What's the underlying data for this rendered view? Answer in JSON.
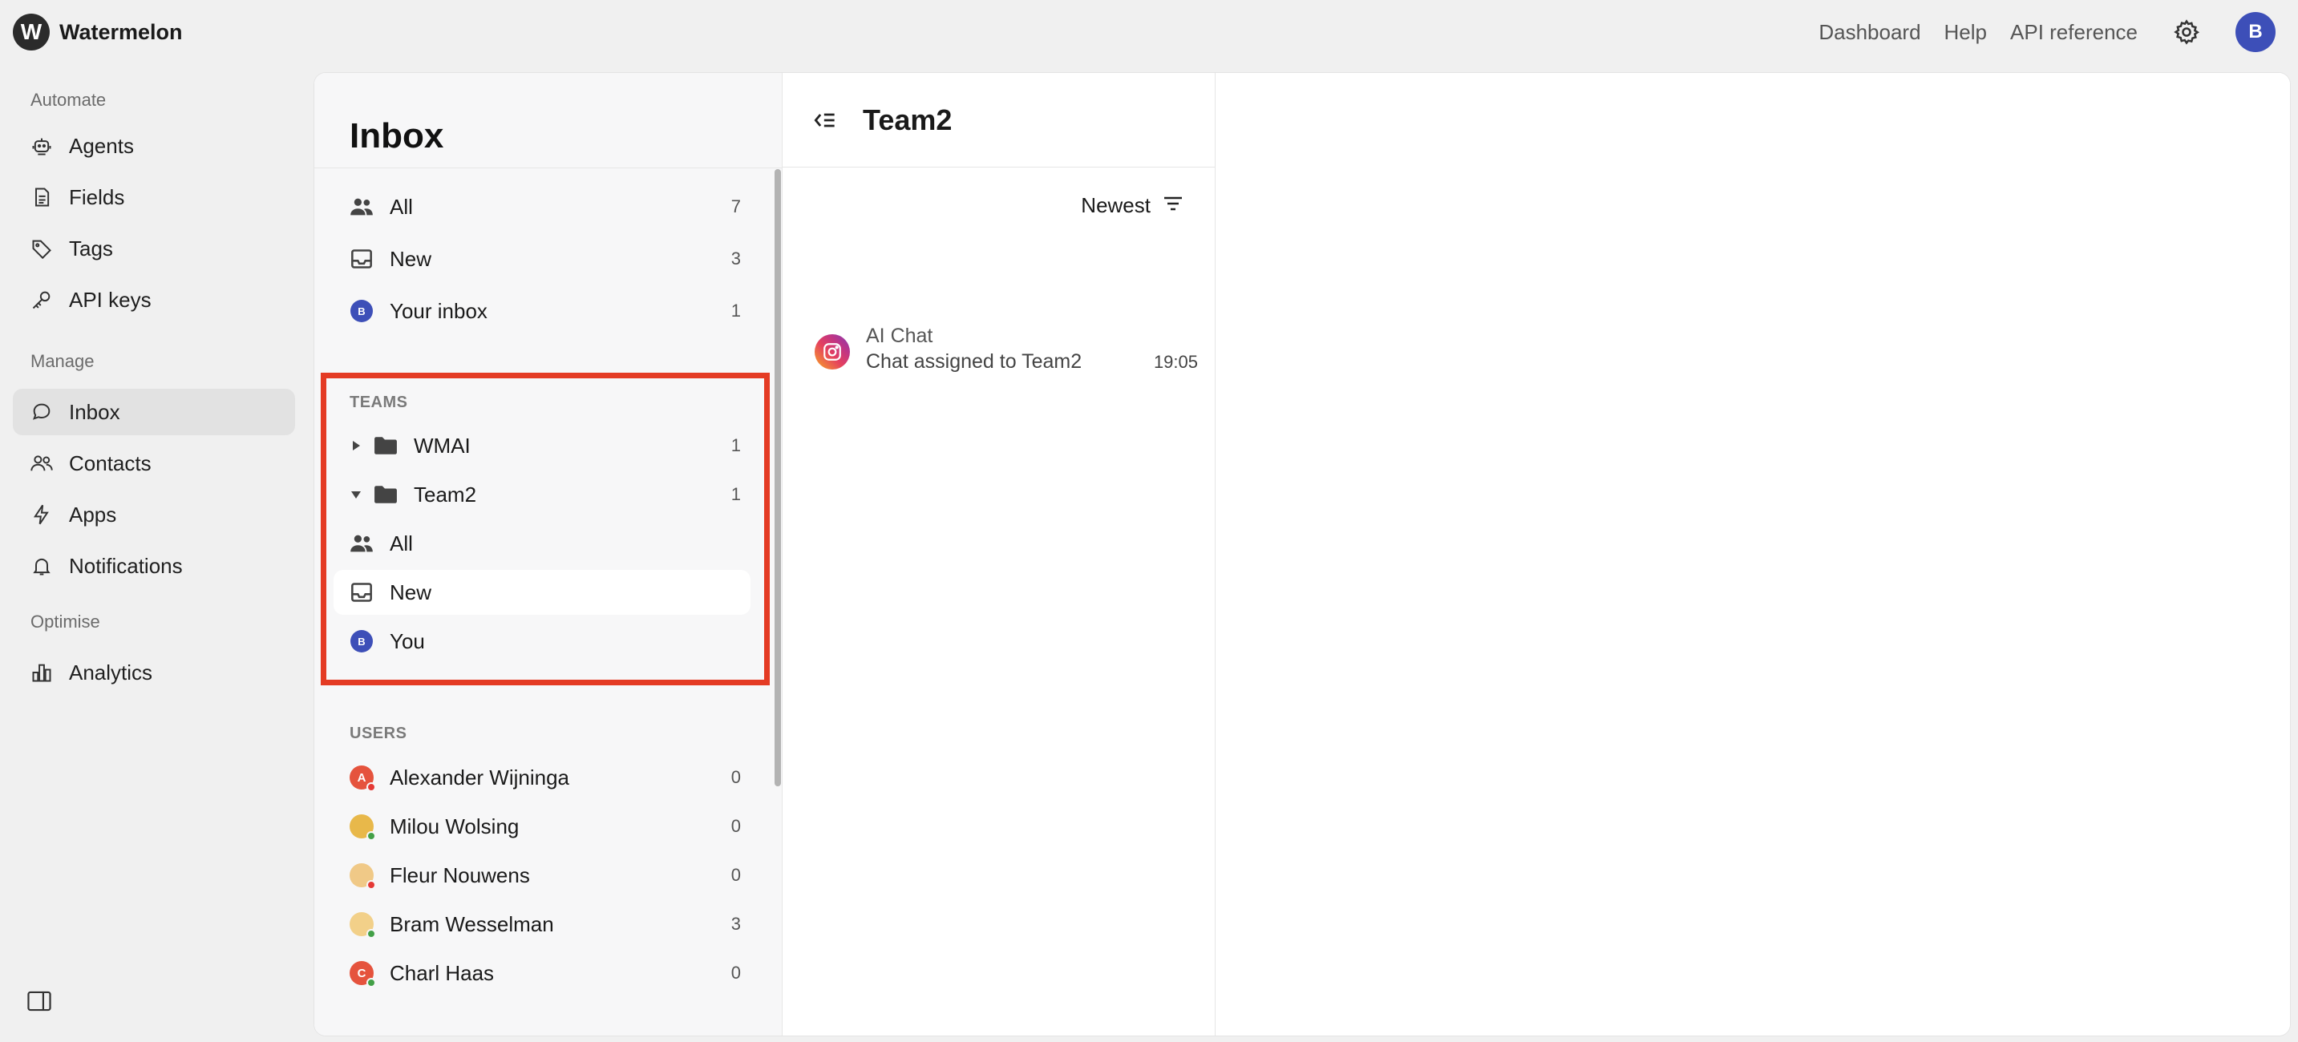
{
  "brand": {
    "logo_letter": "W",
    "name": "Watermelon"
  },
  "topnav": {
    "dashboard": "Dashboard",
    "help": "Help",
    "api_reference": "API reference",
    "avatar_letter": "B"
  },
  "sidebar": {
    "sections": {
      "automate": "Automate",
      "manage": "Manage",
      "optimise": "Optimise"
    },
    "items": [
      {
        "label": "Agents",
        "icon": "robot-icon"
      },
      {
        "label": "Fields",
        "icon": "document-icon"
      },
      {
        "label": "Tags",
        "icon": "tag-icon"
      },
      {
        "label": "API keys",
        "icon": "key-icon"
      },
      {
        "label": "Inbox",
        "icon": "chat-bubble-icon",
        "active": true
      },
      {
        "label": "Contacts",
        "icon": "users-icon"
      },
      {
        "label": "Apps",
        "icon": "lightning-icon"
      },
      {
        "label": "Notifications",
        "icon": "bell-icon"
      },
      {
        "label": "Analytics",
        "icon": "bar-chart-icon"
      }
    ]
  },
  "inbox": {
    "title": "Inbox",
    "views": [
      {
        "label": "All",
        "count": "7"
      },
      {
        "label": "New",
        "count": "3"
      },
      {
        "label": "Your inbox",
        "count": "1",
        "avatar": "B"
      }
    ],
    "teams_label": "TEAMS",
    "teams": [
      {
        "label": "WMAI",
        "count": "1",
        "expanded": false
      },
      {
        "label": "Team2",
        "count": "1",
        "expanded": true
      }
    ],
    "team2_views": [
      {
        "label": "All"
      },
      {
        "label": "New",
        "selected": true
      },
      {
        "label": "You",
        "avatar": "B"
      }
    ],
    "users_label": "USERS",
    "users": [
      {
        "name": "Alexander Wijninga",
        "count": "0",
        "initial": "A",
        "color": "#e5533d",
        "status": "#e53935"
      },
      {
        "name": "Milou Wolsing",
        "count": "0",
        "initial": "",
        "color": "#e8b84a",
        "status": "#43a047"
      },
      {
        "name": "Fleur Nouwens",
        "count": "0",
        "initial": "",
        "color": "#f0c987",
        "status": "#e53935"
      },
      {
        "name": "Bram Wesselman",
        "count": "3",
        "initial": "",
        "color": "#f2d089",
        "status": "#43a047"
      },
      {
        "name": "Charl Haas",
        "count": "0",
        "initial": "C",
        "color": "#e5533d",
        "status": "#43a047"
      }
    ]
  },
  "conversation_list": {
    "title": "Team2",
    "sort_label": "Newest",
    "items": [
      {
        "name": "AI Chat",
        "message": "Chat assigned to Team2",
        "time": "19:05",
        "channel": "instagram-icon"
      }
    ]
  },
  "colors": {
    "accent_avatar": "#3d4fb8",
    "highlight_border": "#e43b24",
    "active_nav_bg": "#e2e2e2"
  }
}
